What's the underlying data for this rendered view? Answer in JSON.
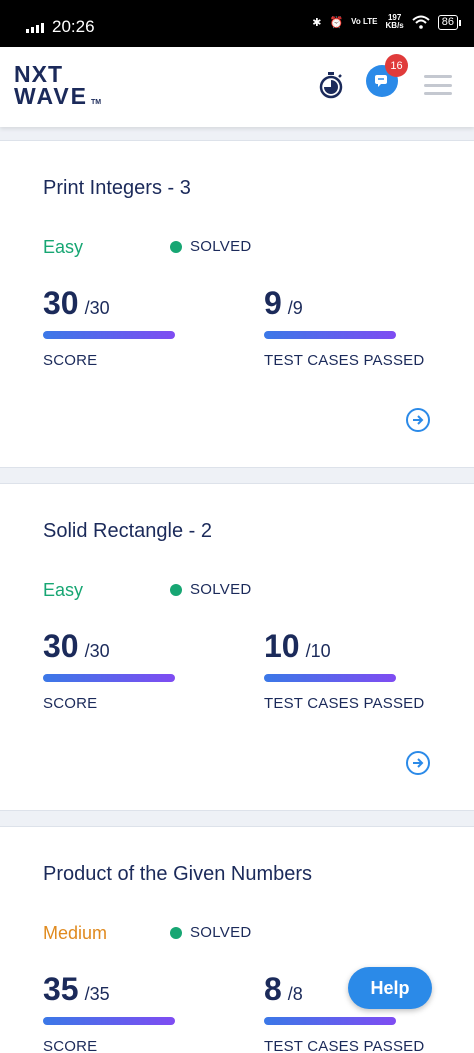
{
  "status_bar": {
    "time": "20:26",
    "network_label_top": "Vo LTE",
    "speed_value": "197",
    "speed_unit": "KB/s",
    "battery": "86"
  },
  "header": {
    "logo_line1": "NXT",
    "logo_line2": "WAVE",
    "logo_tm": "TM",
    "notification_count": "16"
  },
  "colors": {
    "easy": "#17a673",
    "medium": "#e08a1e",
    "accent": "#2b8ae8"
  },
  "problems": [
    {
      "title": "Print Integers - 3",
      "difficulty": "Easy",
      "status": "SOLVED",
      "score": "30",
      "score_total": "/30",
      "score_label": "SCORE",
      "tests": "9",
      "tests_total": "/9",
      "tests_label": "TEST CASES PASSED"
    },
    {
      "title": "Solid Rectangle - 2",
      "difficulty": "Easy",
      "status": "SOLVED",
      "score": "30",
      "score_total": "/30",
      "score_label": "SCORE",
      "tests": "10",
      "tests_total": "/10",
      "tests_label": "TEST CASES PASSED"
    },
    {
      "title": "Product of the Given Numbers",
      "difficulty": "Medium",
      "status": "SOLVED",
      "score": "35",
      "score_total": "/35",
      "score_label": "SCORE",
      "tests": "8",
      "tests_total": "/8",
      "tests_label": "TEST CASES PASSED"
    }
  ],
  "help_label": "Help"
}
